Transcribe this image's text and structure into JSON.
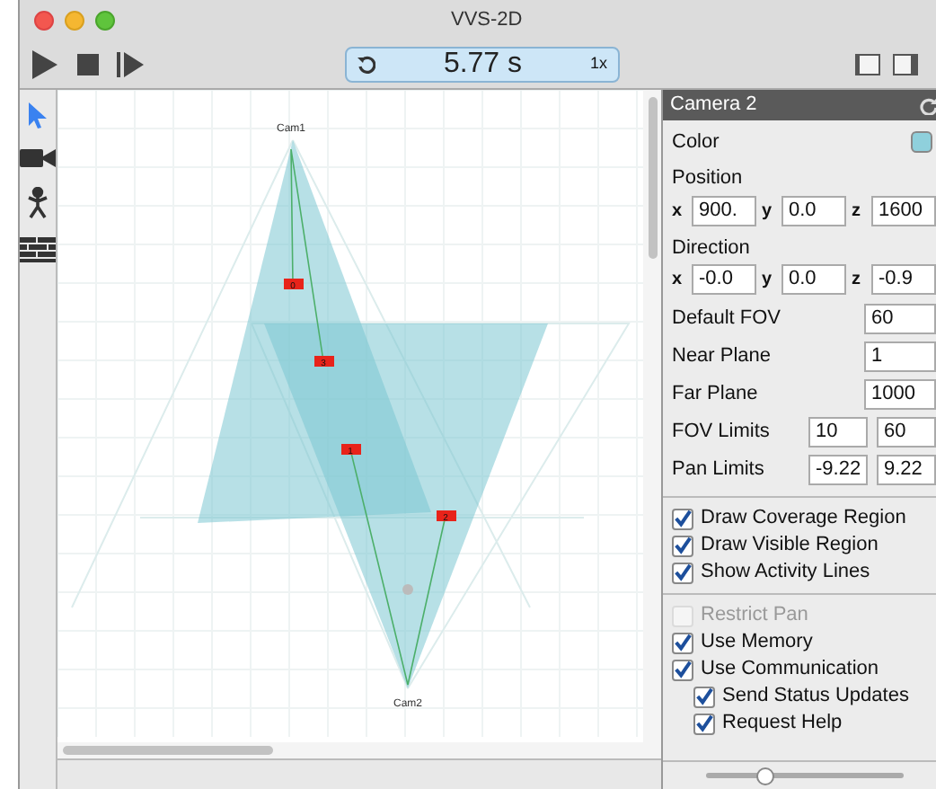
{
  "window": {
    "title": "VVS-2D"
  },
  "toolbar": {
    "time": "5.77 s",
    "speed": "1x"
  },
  "tools": [
    {
      "kind": "pointer",
      "selected": true
    },
    {
      "kind": "camera",
      "selected": false
    },
    {
      "kind": "person",
      "selected": false
    },
    {
      "kind": "wall",
      "selected": false
    }
  ],
  "canvas": {
    "cameras": [
      {
        "label": "Cam1"
      },
      {
        "label": "Cam2"
      }
    ],
    "markers": [
      {
        "label": "0"
      },
      {
        "label": "3"
      },
      {
        "label": "1"
      },
      {
        "label": "2"
      }
    ]
  },
  "inspector": {
    "title": "Camera 2",
    "color_label": "Color",
    "position": {
      "label": "Position",
      "fields": [
        {
          "axis": "x",
          "value": "900."
        },
        {
          "axis": "y",
          "value": "0.0"
        },
        {
          "axis": "z",
          "value": "1600"
        }
      ]
    },
    "direction": {
      "label": "Direction",
      "fields": [
        {
          "axis": "x",
          "value": "-0.0"
        },
        {
          "axis": "y",
          "value": "0.0"
        },
        {
          "axis": "z",
          "value": "-0.9"
        }
      ]
    },
    "settings": [
      {
        "label": "Default FOV",
        "values": [
          "60"
        ]
      },
      {
        "label": "Near Plane",
        "values": [
          "1"
        ]
      },
      {
        "label": "Far Plane",
        "values": [
          "1000"
        ]
      },
      {
        "label": "FOV Limits",
        "values": [
          "10",
          "60"
        ]
      },
      {
        "label": "Pan Limits",
        "values": [
          "-9.22",
          "9.22"
        ]
      }
    ],
    "display_options": [
      {
        "label": "Draw Coverage Region",
        "checked": true,
        "disabled": false
      },
      {
        "label": "Draw Visible Region",
        "checked": true,
        "disabled": false
      },
      {
        "label": "Show Activity Lines",
        "checked": true,
        "disabled": false
      }
    ],
    "behavior_options": [
      {
        "label": "Restrict Pan",
        "checked": false,
        "disabled": true
      },
      {
        "label": "Use Memory",
        "checked": true,
        "disabled": false
      },
      {
        "label": "Use Communication",
        "checked": true,
        "disabled": false,
        "children": [
          {
            "label": "Send Status Updates",
            "checked": true,
            "disabled": false
          },
          {
            "label": "Request Help",
            "checked": true,
            "disabled": false
          }
        ]
      }
    ]
  },
  "zoom_slider": {
    "level": 0.3
  }
}
